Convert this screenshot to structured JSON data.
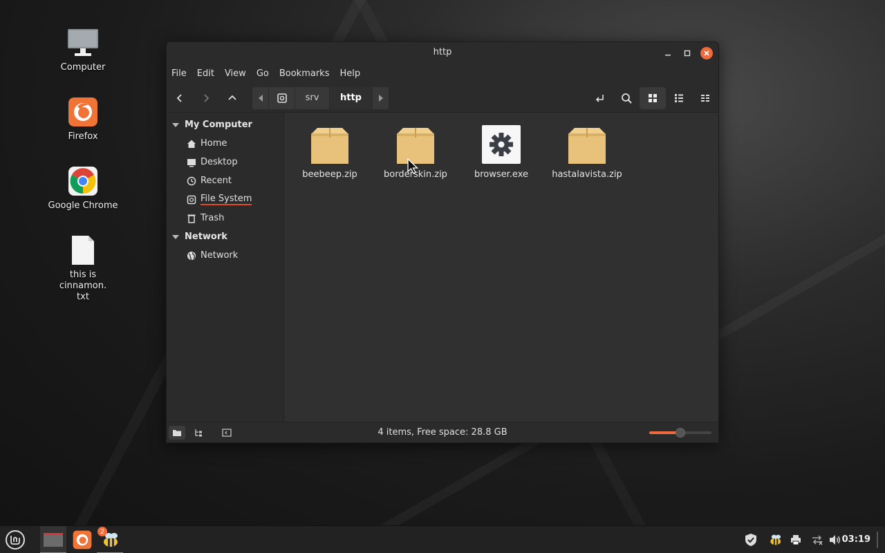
{
  "desktop": {
    "icons": [
      {
        "label": "Computer"
      },
      {
        "label": "Firefox"
      },
      {
        "label": "Google Chrome"
      },
      {
        "label": "this is cinnamon.\ntxt"
      }
    ]
  },
  "window": {
    "title": "http",
    "menu": [
      "File",
      "Edit",
      "View",
      "Go",
      "Bookmarks",
      "Help"
    ],
    "breadcrumb": [
      "srv",
      "http"
    ],
    "sidebar": {
      "sections": [
        {
          "heading": "My Computer",
          "items": [
            "Home",
            "Desktop",
            "Recent",
            "File System",
            "Trash"
          ]
        },
        {
          "heading": "Network",
          "items": [
            "Network"
          ]
        }
      ]
    },
    "files": [
      {
        "name": "beebeep.zip",
        "type": "archive"
      },
      {
        "name": "borderskin.zip",
        "type": "archive"
      },
      {
        "name": "browser.exe",
        "type": "executable"
      },
      {
        "name": "hastalavista.zip",
        "type": "archive"
      }
    ],
    "status": "4 items, Free space: 28.8 GB",
    "zoom_level": 0.5
  },
  "panel": {
    "clock": "03:19",
    "badge": "2"
  },
  "colors": {
    "accent": "#f06a3c",
    "archive": "#e8c27a"
  }
}
